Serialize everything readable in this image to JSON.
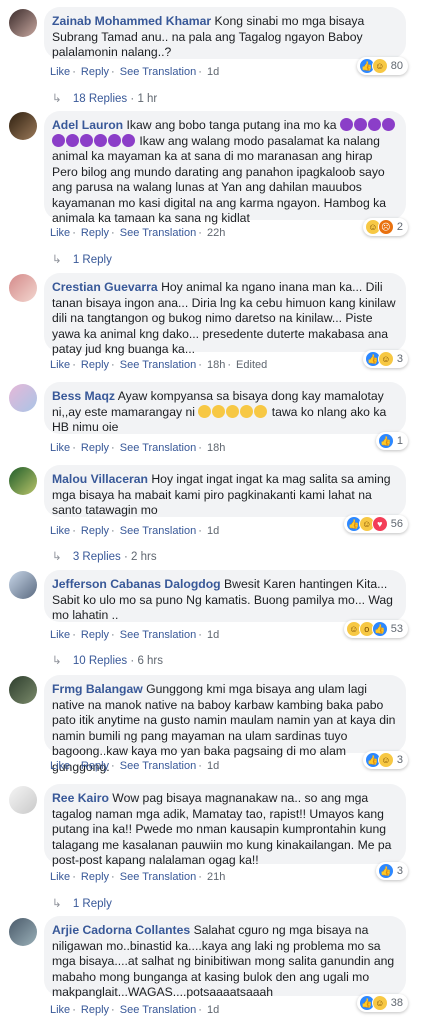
{
  "labels": {
    "like": "Like",
    "reply": "Reply",
    "see_translation": "See Translation",
    "edited": "Edited"
  },
  "comments": [
    {
      "name": "Zainab Mohammed Khamar",
      "text": "Kong sinabi mo mga bisaya Subrang Tamad anu.. na pala ang Tagalog ngayon Baboy palalamonin nalang..?",
      "time": "1d",
      "reaction_count": "80",
      "replies": "18 Replies",
      "replies_time": "1 hr"
    },
    {
      "name": "Adel Lauron",
      "text": "Ikaw ang bobo tanga putang ina mo ka",
      "text2": "Ikaw ang walang modo pasalamat ka nalang animal ka mayaman ka at sana di mo maranasan ang hirap Pero bilog ang mundo darating ang panahon ipagkaloob sayo ang parusa na walang lunas at Yan ang dahilan mauubos kayamanan mo kasi digital na ang karma ngayon. Hambog ka animala ka tamaan ka sana ng kidlat",
      "time": "22h",
      "reaction_count": "2",
      "replies": "1 Reply"
    },
    {
      "name": "Crestian Guevarra",
      "text": "Hoy animal ka ngano inana man ka... Dili tanan bisaya ingon ana... Diria lng ka cebu himuon kang kinilaw dili na tangtangon og bukog nimo daretso na kinilaw... Piste yawa ka animal kng dako... presedente duterte makabasa ana patay jud kng buanga ka...",
      "time": "18h",
      "reaction_count": "3"
    },
    {
      "name": "Bess Maqz",
      "text": "Ayaw kompyansa sa bisaya dong kay mamalotay ni,,ay este mamarangay ni",
      "text2": "tawa ko nlang ako ka HB nimu oie",
      "time": "18h",
      "reaction_count": "1"
    },
    {
      "name": "Malou Villaceran",
      "text": "Hoy ingat ingat ingat ka mag salita sa aming mga bisaya ha mabait kami piro pagkinakanti kami lahat na santo tatawagin mo",
      "time": "1d",
      "reaction_count": "56",
      "replies": "3 Replies",
      "replies_time": "2 hrs"
    },
    {
      "name": "Jefferson Cabanas Dalogdog",
      "text": "Bwesit Karen hantingen Kita... Sabit ko ulo mo sa puno Ng kamatis. Buong pamilya mo... Wag mo lahatin ..",
      "time": "1d",
      "reaction_count": "53",
      "replies": "10 Replies",
      "replies_time": "6 hrs"
    },
    {
      "name": "Frmg Balangaw",
      "text": "Gunggong kmi mga bisaya ang ulam lagi native na manok native na baboy karbaw kambing baka pabo pato itik anytime na gusto namin maulam namin yan at kaya din namin bumili ng pang mayaman na ulam sardinas tuyo bagoong..kaw kaya mo yan baka pagsaing di mo alam gunggong.",
      "time": "1d",
      "reaction_count": "3"
    },
    {
      "name": "Ree Kairo",
      "text": "Wow pag bisaya magnanakaw na.. so ang mga tagalog naman mga adik, Mamatay tao, rapist!! Umayos kang putang ina ka!! Pwede mo nman kausapin kumprontahin kung talagang me kasalanan pauwiin mo kung kinakailangan. Me pa post-post kapang nalalaman ogag ka!!",
      "time": "21h",
      "reaction_count": "3",
      "replies": "1 Reply"
    },
    {
      "name": "Arjie Cadorna Collantes",
      "text": "Salahat cguro ng mga bisaya na niligawan mo..binastid ka....kaya ang laki ng problema mo sa mga bisaya....at salhat ng binibitiwan mong salita ganundin ang mabaho mong bunganga at kasing bulok den ang ugali mo makpanglait...WAGAS....potsaaaatsaaah",
      "time": "1d",
      "reaction_count": "38"
    }
  ]
}
